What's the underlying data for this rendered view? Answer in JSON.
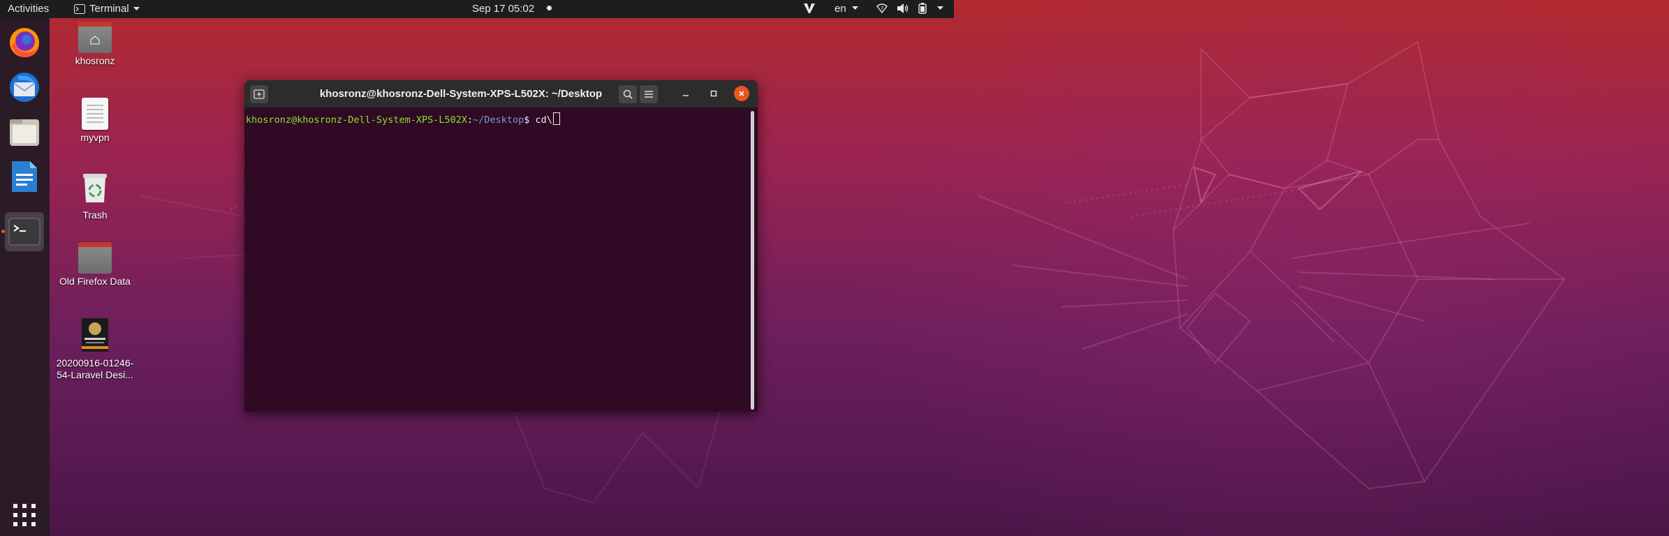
{
  "topbar": {
    "activities": "Activities",
    "app_menu_label": "Terminal",
    "clock": "Sep 17  05:02",
    "language": "en"
  },
  "dock": {
    "apps": [
      "Firefox",
      "Thunderbird",
      "Files",
      "LibreOffice Writer",
      "Terminal"
    ],
    "show_apps": "Show Applications"
  },
  "desktop": {
    "icons": [
      {
        "label": "khosronz"
      },
      {
        "label": "myvpn"
      },
      {
        "label": "Trash"
      },
      {
        "label": "Old Firefox Data"
      },
      {
        "label_line1": "20200916-01246-",
        "label_line2": "54-Laravel Desi..."
      }
    ]
  },
  "terminal": {
    "title": "khosronz@khosronz-Dell-System-XPS-L502X: ~/Desktop",
    "prompt_user": "khosronz@khosronz-Dell-System-XPS-L502X",
    "prompt_sep": ":",
    "prompt_path": "~/Desktop",
    "prompt_end": "$ ",
    "command": "cd\\"
  },
  "colors": {
    "accent": "#e95420",
    "terminal_bg": "#300a24",
    "prompt_user": "#8ae234",
    "prompt_path": "#729fcf"
  }
}
